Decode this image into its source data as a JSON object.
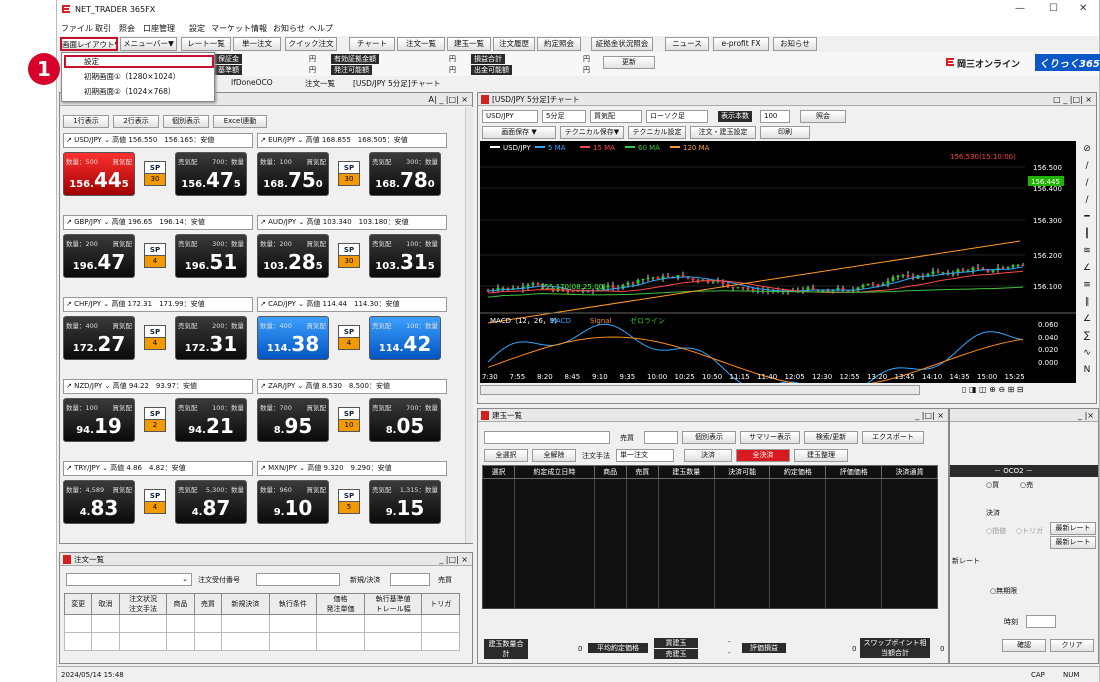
{
  "app": {
    "title": "NET_TRADER 365FX"
  },
  "window_controls": {
    "minimize": "—",
    "maximize": "☐",
    "close": "✕"
  },
  "menu": [
    "ファイル",
    "取引",
    "照会",
    "口座管理",
    "設定",
    "マーケット情報",
    "お知らせ",
    "ヘルプ"
  ],
  "toolbar": [
    "画面レイアウト▼",
    "メニューバー▼",
    "レート一覧",
    "単一注文",
    "クイック注文",
    "チャート",
    "注文一覧",
    "建玉一覧",
    "注文履歴",
    "約定照会",
    "証拠金状況照会",
    "ニュース",
    "e-profit FX",
    "お知らせ"
  ],
  "account": {
    "labels": [
      "保証金",
      "基準額",
      "円",
      "円",
      "有効証拠金額",
      "発注可能額",
      "円",
      "円",
      "損益合計",
      "出金可能額",
      "円",
      "円"
    ],
    "refresh": "更新"
  },
  "brand": {
    "company": "岡三オンライン",
    "logo": "くりっく365"
  },
  "popup": {
    "items": [
      "設定",
      "初期画面①（1280×1024）",
      "初期画面②（1024×768）"
    ]
  },
  "badge": "1",
  "main_tabs": [
    "IfDoneOCO",
    "注文一覧",
    "[USD/JPY 5分足]チャート"
  ],
  "rate_panel": {
    "buttons": [
      "1行表示",
      "2行表示",
      "個別表示",
      "Excel連動"
    ],
    "win_title": "A| _ |□| ×",
    "tiles": [
      {
        "pair": "USD/JPY",
        "info": "高値 156.550　156.165：安値",
        "qty_l": "数量：500",
        "lab_l": "買気配",
        "lab_r": "売気配",
        "qty_r": "700：数量",
        "bid_s": "156.",
        "bid_b": "44",
        "bid_e": "5",
        "sp": "SP",
        "spv": "30",
        "ask_s": "156.",
        "ask_b": "47",
        "ask_e": "5",
        "hl": "red"
      },
      {
        "pair": "EUR/JPY",
        "info": "高値 168.855　168.505：安値",
        "qty_l": "数量：100",
        "lab_l": "買気配",
        "lab_r": "売気配",
        "qty_r": "300：数量",
        "bid_s": "168.",
        "bid_b": "75",
        "bid_e": "0",
        "sp": "SP",
        "spv": "30",
        "ask_s": "168.",
        "ask_b": "78",
        "ask_e": "0",
        "hl": ""
      },
      {
        "pair": "GBP/JPY",
        "info": "高値 196.65　196.14：安値",
        "qty_l": "数量：200",
        "lab_l": "買気配",
        "lab_r": "売気配",
        "qty_r": "300：数量",
        "bid_s": "196.",
        "bid_b": "47",
        "bid_e": "",
        "sp": "SP",
        "spv": "4",
        "ask_s": "196.",
        "ask_b": "51",
        "ask_e": "",
        "hl": ""
      },
      {
        "pair": "AUD/JPY",
        "info": "高値 103.340　103.180：安値",
        "qty_l": "数量：200",
        "lab_l": "買気配",
        "lab_r": "売気配",
        "qty_r": "100：数量",
        "bid_s": "103.",
        "bid_b": "28",
        "bid_e": "5",
        "sp": "SP",
        "spv": "30",
        "ask_s": "103.",
        "ask_b": "31",
        "ask_e": "5",
        "hl": ""
      },
      {
        "pair": "CHF/JPY",
        "info": "高値 172.31　171.99：安値",
        "qty_l": "数量：400",
        "lab_l": "買気配",
        "lab_r": "売気配",
        "qty_r": "200：数量",
        "bid_s": "172.",
        "bid_b": "27",
        "bid_e": "",
        "sp": "SP",
        "spv": "4",
        "ask_s": "172.",
        "ask_b": "31",
        "ask_e": "",
        "hl": ""
      },
      {
        "pair": "CAD/JPY",
        "info": "高値 114.44　114.30：安値",
        "qty_l": "数量：400",
        "lab_l": "買気配",
        "lab_r": "売気配",
        "qty_r": "100：数量",
        "bid_s": "114.",
        "bid_b": "38",
        "bid_e": "",
        "sp": "SP",
        "spv": "4",
        "ask_s": "114.",
        "ask_b": "42",
        "ask_e": "",
        "hl": "blue"
      },
      {
        "pair": "NZD/JPY",
        "info": "高値 94.22　93.97：安値",
        "qty_l": "数量：100",
        "lab_l": "買気配",
        "lab_r": "売気配",
        "qty_r": "100：数量",
        "bid_s": "94.",
        "bid_b": "19",
        "bid_e": "",
        "sp": "SP",
        "spv": "2",
        "ask_s": "94.",
        "ask_b": "21",
        "ask_e": "",
        "hl": ""
      },
      {
        "pair": "ZAR/JPY",
        "info": "高値 8.530　8.500：安値",
        "qty_l": "数量：700",
        "lab_l": "買気配",
        "lab_r": "売気配",
        "qty_r": "700：数量",
        "bid_s": "8.",
        "bid_b": "95",
        "bid_e": "",
        "sp": "SP",
        "spv": "10",
        "ask_s": "8.",
        "ask_b": "05",
        "ask_e": "",
        "hl": ""
      },
      {
        "pair": "TRY/JPY",
        "info": "高値 4.86　4.82：安値",
        "qty_l": "数量：4,589",
        "lab_l": "買気配",
        "lab_r": "売気配",
        "qty_r": "5,300：数量",
        "bid_s": "4.",
        "bid_b": "83",
        "bid_e": "",
        "sp": "SP",
        "spv": "4",
        "ask_s": "4.",
        "ask_b": "87",
        "ask_e": "",
        "hl": ""
      },
      {
        "pair": "MXN/JPY",
        "info": "高値 9.320　9.290：安値",
        "qty_l": "数量：960",
        "lab_l": "買気配",
        "lab_r": "売気配",
        "qty_r": "1,315：数量",
        "bid_s": "9.",
        "bid_b": "10",
        "bid_e": "",
        "sp": "SP",
        "spv": "5",
        "ask_s": "9.",
        "ask_b": "15",
        "ask_e": "",
        "hl": ""
      }
    ]
  },
  "chart": {
    "title": "[USD/JPY 5分足]チャート",
    "controls": [
      "USD/JPY",
      "5分足",
      "買気配",
      "ローソク足",
      "表示本数",
      "100",
      "照会"
    ],
    "buttons": [
      "画面保存 ▼",
      "テクニカル保存▼",
      "テクニカル設定",
      "注文・建玉設定",
      "印刷"
    ],
    "legend": [
      "USD/JPY",
      "5 MA",
      "15 MA",
      "60 MA",
      "120 MA"
    ],
    "legend_colors": [
      "#ffffff",
      "#2ea8ff",
      "#ff4a4a",
      "#3ec43e",
      "#ff9a2a"
    ],
    "yticks": [
      "156.500",
      "156.400",
      "156.300",
      "156.200",
      "156.100"
    ],
    "last_price": "156.445",
    "high_label": "156.530(15:10:00)",
    "low_label": "155.170(08:25:00)",
    "macd_legend": [
      "MACD（12，26，9）",
      "MACD",
      "Signal",
      "ゼロライン"
    ],
    "macd_ticks": [
      "0.060",
      "0.040",
      "0.020",
      "0.000"
    ],
    "xticks": [
      "7:30",
      "7:55",
      "8:20",
      "8:45",
      "9:10",
      "9:35",
      "10:00",
      "10:25",
      "10:50",
      "11:15",
      "11:40",
      "12:05",
      "12:30",
      "12:55",
      "13:20",
      "13:45",
      "14:10",
      "14:35",
      "15:00",
      "15:25"
    ]
  },
  "positions": {
    "title": "建玉一覧",
    "selects": [
      "",
      "売買"
    ],
    "buttons": [
      "個別表示",
      "サマリー表示",
      "検索/更新",
      "エクスポート"
    ],
    "row2": [
      "全選択",
      "全解除",
      "注文手法",
      "単一注文",
      "決済",
      "全決済",
      "建玉整理"
    ],
    "cols": [
      "選択",
      "約定成立日時",
      "商品",
      "売買",
      "建玉数量",
      "決済可能",
      "約定価格",
      "評価価格",
      "決済通貨"
    ],
    "footer": [
      "建玉数量合計",
      "0",
      "平均約定価格",
      "買建玉",
      "売建玉",
      "-",
      "-",
      "評価損益",
      "0",
      "スワップポイント相当額合計",
      "0"
    ]
  },
  "orders": {
    "title": "注文一覧",
    "filter": [
      "注文受付番号",
      "新規/決済",
      "売買"
    ],
    "cols": [
      "変更",
      "取消",
      "注文状況",
      "注文手法",
      "商品",
      "売買",
      "新規決済",
      "執行条件",
      "価格",
      "発注単価",
      "執行基準値",
      "トレール幅",
      "トリガ"
    ]
  },
  "order_panel": {
    "oco": "－ OCO2 －",
    "buy": "○買",
    "sell": "○売",
    "settle": "決済",
    "limit": "○指値",
    "trig": "○トリガ",
    "latest": "最新レート",
    "latest2": "最新レート",
    "rate": "新レート",
    "nolimit": "○無期限",
    "time": "時刻",
    "confirm": "確認",
    "clear": "クリア"
  },
  "status": {
    "datetime": "2024/05/14 15:48",
    "cap": "CAP",
    "num": "NUM"
  }
}
